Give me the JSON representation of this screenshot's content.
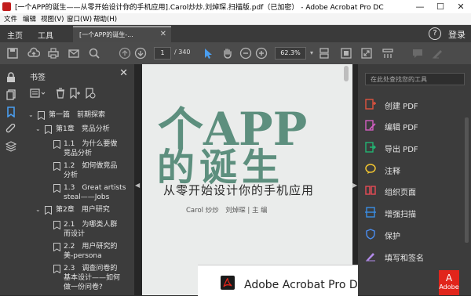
{
  "window": {
    "title": "[一个APP的诞生——从零开始设计你的手机应用].Carol炒炒.刘焯琛.扫描版.pdf（已加密） - Adobe Acrobat Pro DC",
    "controls": {
      "minimize": "—",
      "maximize": "☐",
      "close": "✕"
    }
  },
  "menu": [
    "文件",
    "编辑",
    "视图(V)",
    "窗口(W)",
    "帮助(H)"
  ],
  "tabs": {
    "home": "主页",
    "tools": "工具",
    "document": "[一个APP的诞生-...",
    "help": "?",
    "login": "登录"
  },
  "toolbar": {
    "page_current": "1",
    "page_total": "/ 340",
    "zoom": "62.3%"
  },
  "bookmarks": {
    "title": "书签",
    "items": [
      {
        "label": "第一篇　前期探索"
      },
      {
        "label": "第1章　竞品分析"
      },
      {
        "label": "1.1　为什么要做竞品分析",
        "line1": "1.1　为什么要做",
        "line2": "竞品分析"
      },
      {
        "label": "1.2　如何做竞品分析",
        "line1": "1.2　如何做竞品",
        "line2": "分析"
      },
      {
        "label": "1.3　Great artists steal——Jobs",
        "line1": "1.3　Great artists",
        "line2": "steal——Jobs"
      },
      {
        "label": "第2章　用户研究"
      },
      {
        "label": "2.1　为哪类人群而设计",
        "line1": "2.1　为哪类人群",
        "line2": "而设计"
      },
      {
        "label": "2.2　用户研究的美-persona",
        "line1": "2.2　用户研究的",
        "line2": "美-persona"
      },
      {
        "label": "2.3　调查问卷的基本设计——如何做一份问卷?",
        "line1": "2.3　调查问卷的",
        "line2": "基本设计——如何",
        "line3": "做一份问卷?"
      }
    ]
  },
  "document": {
    "title_line1": "个APP",
    "title_line2": "的诞生",
    "subtitle": "从零开始设计你的手机应用",
    "authors": "Carol 炒炒　刘焯琛 | 主 编",
    "promo_text": "Adobe Acrobat Pro DC",
    "badge": "Adobe"
  },
  "tools_panel": {
    "search_placeholder": "在此处查找您的工具",
    "items": [
      {
        "label": "创建 PDF",
        "color": "#e0533f",
        "icon": "create-pdf-icon"
      },
      {
        "label": "编辑 PDF",
        "color": "#d35ec3",
        "icon": "edit-pdf-icon"
      },
      {
        "label": "导出 PDF",
        "color": "#22b573",
        "icon": "export-pdf-icon"
      },
      {
        "label": "注释",
        "color": "#f2c530",
        "icon": "comment-icon"
      },
      {
        "label": "组织页面",
        "color": "#e84b55",
        "icon": "organize-pages-icon"
      },
      {
        "label": "增强扫描",
        "color": "#3a8ee6",
        "icon": "enhance-scan-icon"
      },
      {
        "label": "保护",
        "color": "#4a8ef2",
        "icon": "protect-icon"
      },
      {
        "label": "填写和签名",
        "color": "#b18ae8",
        "icon": "fill-sign-icon"
      }
    ]
  },
  "colors": {
    "accent_blue": "#4a9ef0",
    "title_green": "#5d8f7e",
    "adobe_red": "#e1251b"
  }
}
